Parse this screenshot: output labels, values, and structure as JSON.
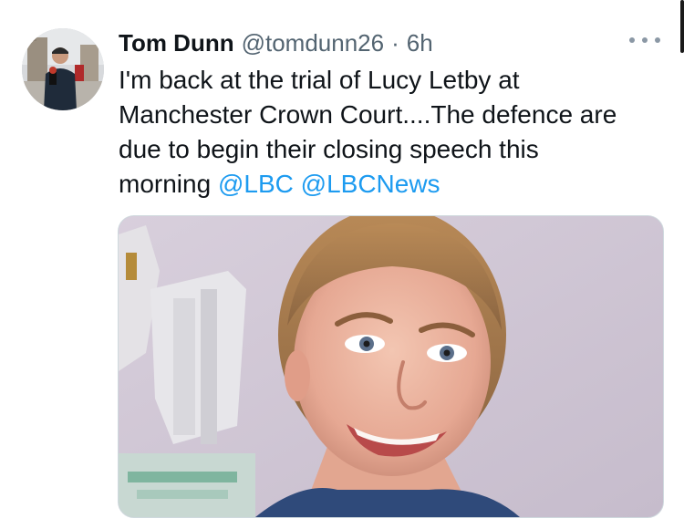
{
  "tweet": {
    "author_name": "Tom Dunn",
    "handle": "@tomdunn26",
    "separator": "·",
    "time": "6h",
    "text_lines": [
      "I'm back at the trial of Lucy Letby at",
      "Manchester Crown Court....The defence are",
      "due to begin their closing speech this"
    ],
    "last_line_text": "morning",
    "mentions": [
      "@LBC",
      "@LBCNews"
    ]
  },
  "icons": {
    "more": "more-options-icon"
  },
  "colors": {
    "text_primary": "#0f1419",
    "text_secondary": "#536471",
    "link": "#1d9bf0",
    "media_border": "#cfd9de"
  }
}
